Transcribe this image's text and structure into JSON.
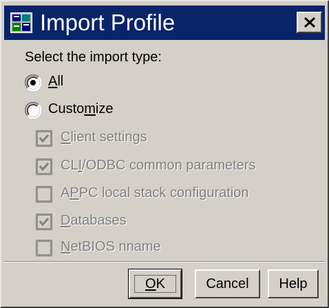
{
  "window": {
    "title": "Import Profile",
    "close_label": "×"
  },
  "prompt": "Select the import type:",
  "radios": [
    {
      "label_mnemonic": "A",
      "label_rest": "ll",
      "checked": true
    },
    {
      "label_pre": "Custo",
      "label_mnemonic": "m",
      "label_post": "ize",
      "checked": false
    }
  ],
  "checkboxes": [
    {
      "pre": "",
      "mnemonic": "C",
      "post": "lient settings",
      "checked": true,
      "enabled": false
    },
    {
      "pre": "CL",
      "mnemonic": "I",
      "post": "/ODBC common parameters",
      "checked": true,
      "enabled": false
    },
    {
      "pre": "A",
      "mnemonic": "P",
      "post": "PC local stack configuration",
      "checked": false,
      "enabled": false
    },
    {
      "pre": "",
      "mnemonic": "D",
      "post": "atabases",
      "checked": true,
      "enabled": false
    },
    {
      "pre": "",
      "mnemonic": "N",
      "post": "etBIOS nname",
      "checked": false,
      "enabled": false
    }
  ],
  "buttons": {
    "ok_mnemonic": "O",
    "ok_rest": "K",
    "cancel": "Cancel",
    "help": "Help"
  },
  "colors": {
    "titlebar": "#0a246a",
    "face": "#d4d0c8",
    "disabled_text": "#808080"
  },
  "icons": {
    "app": "import-profile-app-icon",
    "close": "close-icon"
  }
}
